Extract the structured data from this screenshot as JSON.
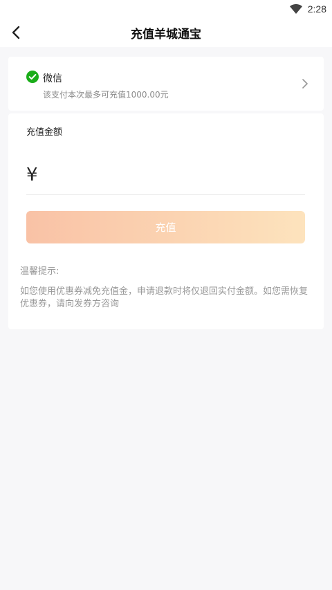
{
  "status_bar": {
    "time": "2:28",
    "icons": [
      "wifi-icon"
    ]
  },
  "header": {
    "title": "充值羊城通宝",
    "back_icon": "chevron-left-icon"
  },
  "payment": {
    "method_name": "微信",
    "limit_text": "该支付本次最多可充值1000.00元",
    "icon": "wechat-pay-icon",
    "brand_color": "#1aad19",
    "chevron_icon": "chevron-right-icon"
  },
  "amount": {
    "label": "充值金额",
    "currency_symbol": "¥",
    "value": "",
    "placeholder": ""
  },
  "recharge_button": {
    "label": "充值",
    "gradient": [
      "#f9c2a6",
      "#fde3bd"
    ]
  },
  "tips": {
    "title": "温馨提示:",
    "body": "如您使用优惠券减免充值金，申请退款时将仅退回实付金额。如您需恢复优惠券，请向发券方咨询"
  }
}
